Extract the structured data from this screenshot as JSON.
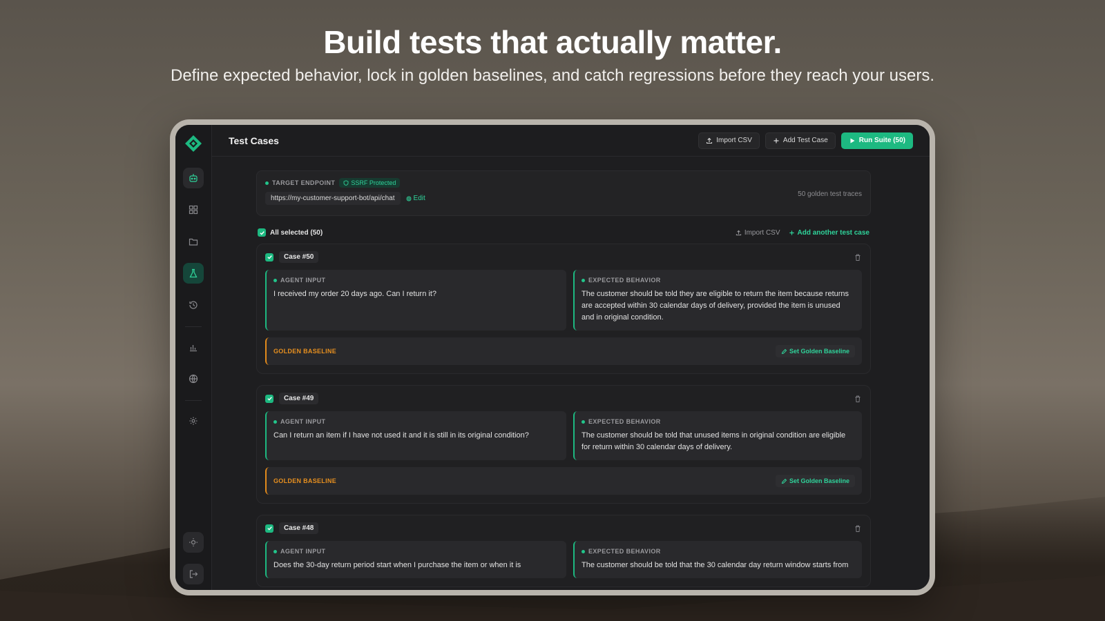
{
  "hero": {
    "title": "Build tests that actually matter.",
    "subtitle": "Define expected behavior, lock in golden baselines, and catch regressions before they reach your users."
  },
  "colors": {
    "accent": "#1db981",
    "baseline": "#e38a1b",
    "background": "#1e1e20"
  },
  "sidebar": {
    "icons": [
      "bot-icon",
      "dashboard-icon",
      "folder-icon",
      "flask-icon",
      "history-icon",
      "chart-icon",
      "globe-icon",
      "settings-icon",
      "theme-icon",
      "logout-icon"
    ],
    "active": "flask-icon"
  },
  "topbar": {
    "title": "Test Cases",
    "import_label": "Import  CSV",
    "add_label": "Add  Test Case",
    "run_label": "Run Suite (50)"
  },
  "endpoint": {
    "label": "TARGET ENDPOINT",
    "badge": "SSRF Protected",
    "url": "https://my-customer-support-bot/api/chat",
    "edit_label": "Edit",
    "traces": "50 golden test traces"
  },
  "selection": {
    "label": "All selected (50)",
    "import_label": "Import CSV",
    "add_label": "Add another test case"
  },
  "labels": {
    "agent_input": "AGENT INPUT",
    "expected_behavior": "EXPECTED BEHAVIOR",
    "golden_baseline": "GOLDEN BASELINE",
    "set_golden_baseline": "Set Golden Baseline"
  },
  "cases": [
    {
      "tag": "Case #50",
      "input": "I received my order 20 days ago. Can I return it?",
      "expected": "The customer should be told they are eligible to return the item because returns are accepted within 30 calendar days of delivery, provided the item is unused and in original condition."
    },
    {
      "tag": "Case #49",
      "input": "Can I return an item if I have not used it and it is still in its original condition?",
      "expected": "The customer should be told that unused items in original condition are eligible for return within 30 calendar days of delivery."
    },
    {
      "tag": "Case #48",
      "input": "Does the 30-day return period start when I purchase the item or when it is",
      "expected": "The customer should be told that the 30 calendar day return window starts from"
    }
  ]
}
